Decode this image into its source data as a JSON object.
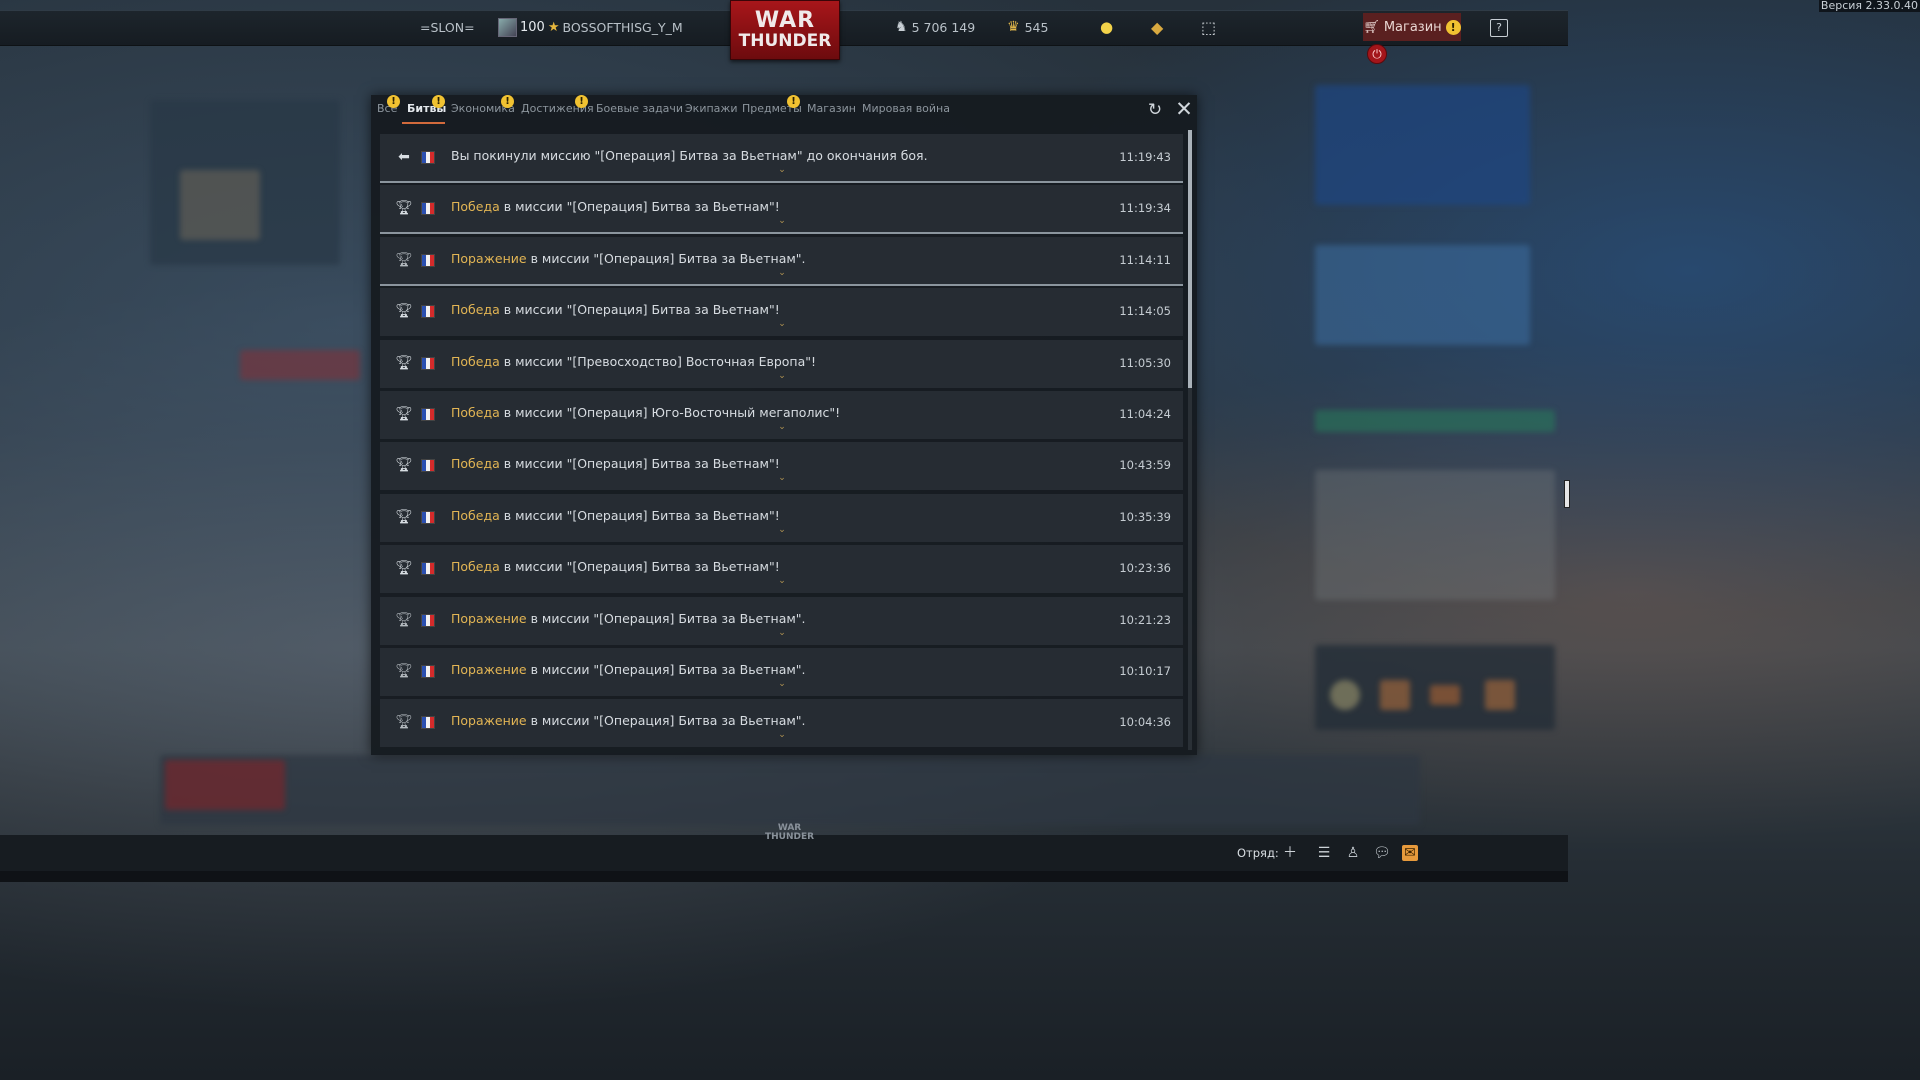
{
  "version": "Версия 2.33.0.40",
  "topbar": {
    "clan_tag": "=SLON=",
    "player_level": "100",
    "player_name": "BOSSOFTHISG_Y_M",
    "logo_line1": "WAR",
    "logo_line2": "THUNDER",
    "silver_lions": "5 706 149",
    "golden_eagles": "545",
    "shop_label": "Магазин",
    "icons": [
      "clan-icon",
      "star-icon",
      "silver-lions-icon",
      "golden-eagles-icon",
      "lightbulb-icon",
      "diamond-icon",
      "ticket-icon",
      "cart-icon",
      "help-icon",
      "power-icon"
    ]
  },
  "colors": {
    "accent": "#d26a3c",
    "keyword": "#e2b554",
    "alert": "#f1c231",
    "logo_red": "#a8161a",
    "mail_orange": "#e79a3c"
  },
  "modal": {
    "tabs": [
      {
        "label": "Все",
        "alert": true
      },
      {
        "label": "Битвы",
        "alert": true,
        "active": true
      },
      {
        "label": "Экономика",
        "alert": true
      },
      {
        "label": "Достижения",
        "alert": true
      },
      {
        "label": "Боевые задачи",
        "alert": false
      },
      {
        "label": "Экипажи",
        "alert": false
      },
      {
        "label": "Предметы",
        "alert": true
      },
      {
        "label": "Магазин",
        "alert": false
      },
      {
        "label": "Мировая война",
        "alert": false
      }
    ],
    "alert_symbol": "!",
    "rows": [
      {
        "icon": "exit-mission-icon",
        "keyword": "",
        "text": "Вы покинули миссию \"[Операция] Битва за Вьетнам\" до окончания боя.",
        "time": "11:19:43"
      },
      {
        "icon": "trophy-victory-icon",
        "keyword": "Победа",
        "text": " в миссии \"[Операция] Битва за Вьетнам\"!",
        "time": "11:19:34"
      },
      {
        "icon": "trophy-defeat-icon",
        "keyword": "Поражение",
        "text": " в миссии \"[Операция] Битва за Вьетнам\".",
        "time": "11:14:11"
      },
      {
        "icon": "trophy-victory-icon",
        "keyword": "Победа",
        "text": " в миссии \"[Операция] Битва за Вьетнам\"!",
        "time": "11:14:05"
      },
      {
        "icon": "trophy-victory-icon",
        "keyword": "Победа",
        "text": " в миссии \"[Превосходство] Восточная Европа\"!",
        "time": "11:05:30"
      },
      {
        "icon": "trophy-victory-icon",
        "keyword": "Победа",
        "text": " в миссии \"[Операция] Юго-Восточный мегаполис\"!",
        "time": "11:04:24"
      },
      {
        "icon": "trophy-victory-icon",
        "keyword": "Победа",
        "text": " в миссии \"[Операция] Битва за Вьетнам\"!",
        "time": "10:43:59"
      },
      {
        "icon": "trophy-victory-icon",
        "keyword": "Победа",
        "text": " в миссии \"[Операция] Битва за Вьетнам\"!",
        "time": "10:35:39"
      },
      {
        "icon": "trophy-victory-icon",
        "keyword": "Победа",
        "text": " в миссии \"[Операция] Битва за Вьетнам\"!",
        "time": "10:23:36"
      },
      {
        "icon": "trophy-defeat-icon",
        "keyword": "Поражение",
        "text": " в миссии \"[Операция] Битва за Вьетнам\".",
        "time": "10:21:23"
      },
      {
        "icon": "trophy-defeat-icon",
        "keyword": "Поражение",
        "text": " в миссии \"[Операция] Битва за Вьетнам\".",
        "time": "10:10:17"
      },
      {
        "icon": "trophy-defeat-icon",
        "keyword": "Поражение",
        "text": " в миссии \"[Операция] Битва за Вьетнам\".",
        "time": "10:04:36"
      }
    ]
  },
  "bottombar": {
    "logo_line1": "WAR",
    "logo_line2": "THUNDER",
    "squad_label": "Отряд:"
  }
}
